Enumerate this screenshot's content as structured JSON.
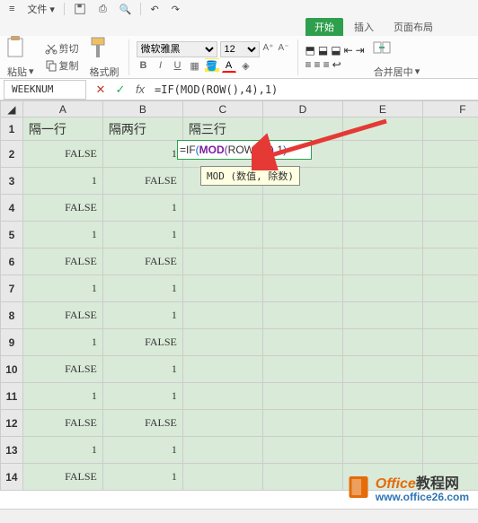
{
  "menu": {
    "file": "文件",
    "cut": "剪切",
    "copy": "复制"
  },
  "tabs": {
    "start": "开始",
    "insert": "插入",
    "layout": "页面布局"
  },
  "ribbon": {
    "paste": "粘贴",
    "format_painter": "格式刷",
    "font_name": "微软雅黑",
    "font_size": "12",
    "merge": "合并居中"
  },
  "namebox": "WEEKNUM",
  "formula": "=IF(MOD(ROW(),4),1)",
  "tooltip": "MOD (数值, 除数)",
  "headers": {
    "A": "隔一行",
    "B": "隔两行",
    "C": "隔三行"
  },
  "columns": [
    "A",
    "B",
    "C",
    "D",
    "E",
    "F"
  ],
  "cells": {
    "r2": {
      "A": "FALSE",
      "B": "1",
      "C_formula": {
        "pre": "=IF",
        "open1": "(",
        "fn": "MOD",
        "open2": "(",
        "r": "ROW",
        "open3": "(",
        "close3": ")",
        "c1": ",",
        "n1": "4",
        "close2": ")",
        "c2": ",",
        "n2": "1",
        "close1": ")"
      }
    },
    "r3": {
      "A": "1",
      "B": "FALSE"
    },
    "r4": {
      "A": "FALSE",
      "B": "1"
    },
    "r5": {
      "A": "1",
      "B": "1"
    },
    "r6": {
      "A": "FALSE",
      "B": "FALSE"
    },
    "r7": {
      "A": "1",
      "B": "1"
    },
    "r8": {
      "A": "FALSE",
      "B": "1"
    },
    "r9": {
      "A": "1",
      "B": "FALSE"
    },
    "r10": {
      "A": "FALSE",
      "B": "1"
    },
    "r11": {
      "A": "1",
      "B": "1"
    },
    "r12": {
      "A": "FALSE",
      "B": "FALSE"
    },
    "r13": {
      "A": "1",
      "B": "1"
    },
    "r14": {
      "A": "FALSE",
      "B": "1"
    }
  },
  "watermark": {
    "brand1": "Office",
    "brand2": "教程网",
    "url": "www.office26.com"
  }
}
